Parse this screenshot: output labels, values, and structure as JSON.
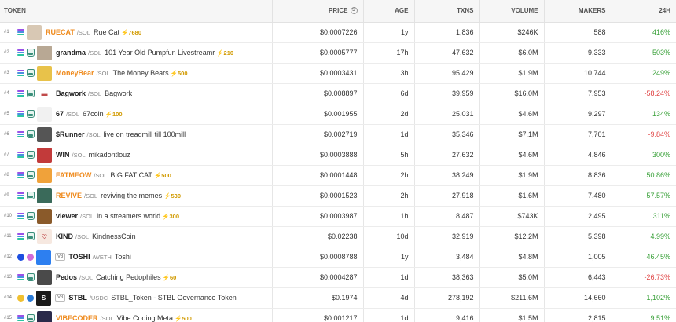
{
  "headers": {
    "token": "TOKEN",
    "price": "PRICE",
    "price_info_icon": "S",
    "age": "AGE",
    "txns": "TXNS",
    "volume": "VOLUME",
    "makers": "MAKERS",
    "change24h": "24H"
  },
  "rows": [
    {
      "rank": "#1",
      "symbol": "RUECAT",
      "hot": true,
      "pair": "/SOL",
      "name": "Rue Cat",
      "boost": "⚡7680",
      "price": "$0.0007226",
      "age": "1y",
      "txns": "1,836",
      "volume": "$246K",
      "makers": "588",
      "change": "416%",
      "dir": "up",
      "logo_bg": "#d8c8b4",
      "logo_text": "",
      "chain": "solana",
      "dex": false
    },
    {
      "rank": "#2",
      "symbol": "grandma",
      "hot": false,
      "pair": "/SOL",
      "name": "101 Year Old Pumpfun Livestreamr",
      "boost": "⚡210",
      "price": "$0.0005777",
      "age": "17h",
      "txns": "47,632",
      "volume": "$6.0M",
      "makers": "9,333",
      "change": "503%",
      "dir": "up",
      "logo_bg": "#b8a894",
      "logo_text": "",
      "chain": "solana",
      "dex": true
    },
    {
      "rank": "#3",
      "symbol": "MoneyBear",
      "hot": true,
      "pair": "/SOL",
      "name": "The Money Bears",
      "boost": "⚡500",
      "price": "$0.0003431",
      "age": "3h",
      "txns": "95,429",
      "volume": "$1.9M",
      "makers": "10,744",
      "change": "249%",
      "dir": "up",
      "logo_bg": "#e8c24a",
      "logo_text": "",
      "chain": "solana",
      "dex": true
    },
    {
      "rank": "#4",
      "symbol": "Bagwork",
      "hot": false,
      "pair": "/SOL",
      "name": "Bagwork",
      "boost": "",
      "price": "$0.008897",
      "age": "6d",
      "txns": "39,959",
      "volume": "$16.0M",
      "makers": "7,953",
      "change": "-58.24%",
      "dir": "down",
      "logo_bg": "#ffffff",
      "logo_text": "▬",
      "chain": "solana",
      "dex": true
    },
    {
      "rank": "#5",
      "symbol": "67",
      "hot": false,
      "pair": "/SOL",
      "name": "67coin",
      "boost": "⚡100",
      "price": "$0.001955",
      "age": "2d",
      "txns": "25,031",
      "volume": "$4.6M",
      "makers": "9,297",
      "change": "134%",
      "dir": "up",
      "logo_bg": "#f1f1f1",
      "logo_text": "",
      "chain": "solana",
      "dex": true
    },
    {
      "rank": "#6",
      "symbol": "$Runner",
      "hot": false,
      "pair": "/SOL",
      "name": "live on treadmill till 100mill",
      "boost": "",
      "price": "$0.002719",
      "age": "1d",
      "txns": "35,346",
      "volume": "$7.1M",
      "makers": "7,701",
      "change": "-9.84%",
      "dir": "down",
      "logo_bg": "#555555",
      "logo_text": "",
      "chain": "solana",
      "dex": true
    },
    {
      "rank": "#7",
      "symbol": "WIN",
      "hot": false,
      "pair": "/SOL",
      "name": "mikadontlouz",
      "boost": "",
      "price": "$0.0003888",
      "age": "5h",
      "txns": "27,632",
      "volume": "$4.6M",
      "makers": "4,846",
      "change": "300%",
      "dir": "up",
      "logo_bg": "#c23a3a",
      "logo_text": "",
      "chain": "solana",
      "dex": true
    },
    {
      "rank": "#8",
      "symbol": "FATMEOW",
      "hot": true,
      "pair": "/SOL",
      "name": "BIG FAT CAT",
      "boost": "⚡500",
      "price": "$0.0001448",
      "age": "2h",
      "txns": "38,249",
      "volume": "$1.9M",
      "makers": "8,836",
      "change": "50.86%",
      "dir": "up",
      "logo_bg": "#f0a23a",
      "logo_text": "",
      "chain": "solana",
      "dex": true
    },
    {
      "rank": "#9",
      "symbol": "REVIVE",
      "hot": true,
      "pair": "/SOL",
      "name": "reviving the memes",
      "boost": "⚡530",
      "price": "$0.0001523",
      "age": "2h",
      "txns": "27,918",
      "volume": "$1.6M",
      "makers": "7,480",
      "change": "57.57%",
      "dir": "up",
      "logo_bg": "#3a6a5a",
      "logo_text": "",
      "chain": "solana",
      "dex": true
    },
    {
      "rank": "#10",
      "symbol": "viewer",
      "hot": false,
      "pair": "/SOL",
      "name": "in a streamers world",
      "boost": "⚡300",
      "price": "$0.0003987",
      "age": "1h",
      "txns": "8,487",
      "volume": "$743K",
      "makers": "2,495",
      "change": "311%",
      "dir": "up",
      "logo_bg": "#8a5a2a",
      "logo_text": "",
      "chain": "solana",
      "dex": true
    },
    {
      "rank": "#11",
      "symbol": "KIND",
      "hot": false,
      "pair": "/SOL",
      "name": "KindnessCoin",
      "boost": "",
      "price": "$0.02238",
      "age": "10d",
      "txns": "32,919",
      "volume": "$12.2M",
      "makers": "5,398",
      "change": "4.99%",
      "dir": "up",
      "logo_bg": "#f6e8e0",
      "logo_text": "♡",
      "chain": "solana",
      "dex": true
    },
    {
      "rank": "#12",
      "symbol": "TOSHI",
      "hot": false,
      "pair": "/WETH",
      "name": "Toshi",
      "boost": "",
      "price": "$0.0008788",
      "age": "1y",
      "txns": "3,484",
      "volume": "$4.8M",
      "makers": "1,005",
      "change": "46.45%",
      "dir": "up",
      "logo_bg": "#2d7ff0",
      "logo_text": "",
      "chain": "base",
      "dex": false,
      "v3": "V3",
      "quote_color": "#d06bd8"
    },
    {
      "rank": "#13",
      "symbol": "Pedos",
      "hot": false,
      "pair": "/SOL",
      "name": "Catching Pedophiles",
      "boost": "⚡60",
      "price": "$0.0004287",
      "age": "1d",
      "txns": "38,363",
      "volume": "$5.0M",
      "makers": "6,443",
      "change": "-26.73%",
      "dir": "down",
      "logo_bg": "#4a4a4a",
      "logo_text": "",
      "chain": "solana",
      "dex": true
    },
    {
      "rank": "#14",
      "symbol": "STBL",
      "hot": false,
      "pair": "/USDC",
      "name": "STBL_Token - STBL Governance Token",
      "boost": "",
      "price": "$0.1974",
      "age": "4d",
      "txns": "278,192",
      "volume": "$211.6M",
      "makers": "14,660",
      "change": "1,102%",
      "dir": "up",
      "logo_bg": "#1a1a1a",
      "logo_text": "S",
      "chain": "coin",
      "dex": false,
      "v3": "V3",
      "quote_color": "#2a7ad6"
    },
    {
      "rank": "#15",
      "symbol": "VIBECODER",
      "hot": true,
      "pair": "/SOL",
      "name": "Vibe Coding Meta",
      "boost": "⚡500",
      "price": "$0.001217",
      "age": "1d",
      "txns": "9,416",
      "volume": "$1.5M",
      "makers": "2,815",
      "change": "9.51%",
      "dir": "up",
      "logo_bg": "#2a2a4a",
      "logo_text": "",
      "chain": "solana",
      "dex": true
    }
  ]
}
